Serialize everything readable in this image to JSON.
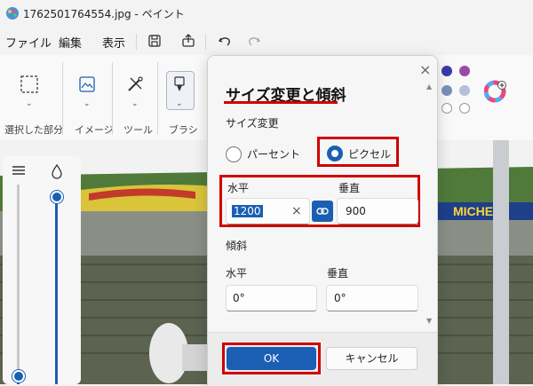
{
  "window": {
    "title": "1762501764554.jpg - ペイント"
  },
  "menu": {
    "file": "ファイル",
    "edit": "編集",
    "view": "表示"
  },
  "ribbon": {
    "selection": "選択した部分",
    "image": "イメージ",
    "tools": "ツール",
    "brushes": "ブラシ"
  },
  "colors": {
    "swatches": [
      "#3a3aa8",
      "#9b4aa8",
      "#7a8fb8",
      "#b5bfdc",
      "#ffffff",
      "#ffffff"
    ],
    "accent": "#1a5fb4",
    "highlight": "#d00000"
  },
  "dialog": {
    "title": "サイズ変更と傾斜",
    "resize_section": "サイズ変更",
    "percent_label": "パーセント",
    "pixel_label": "ピクセル",
    "selected_unit": "ピクセル",
    "horizontal_label": "水平",
    "vertical_label": "垂直",
    "horizontal_value": "1200",
    "vertical_value": "900",
    "clear_glyph": "×",
    "skew_section": "傾斜",
    "skew_horizontal_label": "水平",
    "skew_vertical_label": "垂直",
    "skew_horizontal_value": "0°",
    "skew_vertical_value": "0°",
    "ok_label": "OK",
    "cancel_label": "キャンセル"
  },
  "canvas": {
    "banner_text": "MICHELI"
  }
}
